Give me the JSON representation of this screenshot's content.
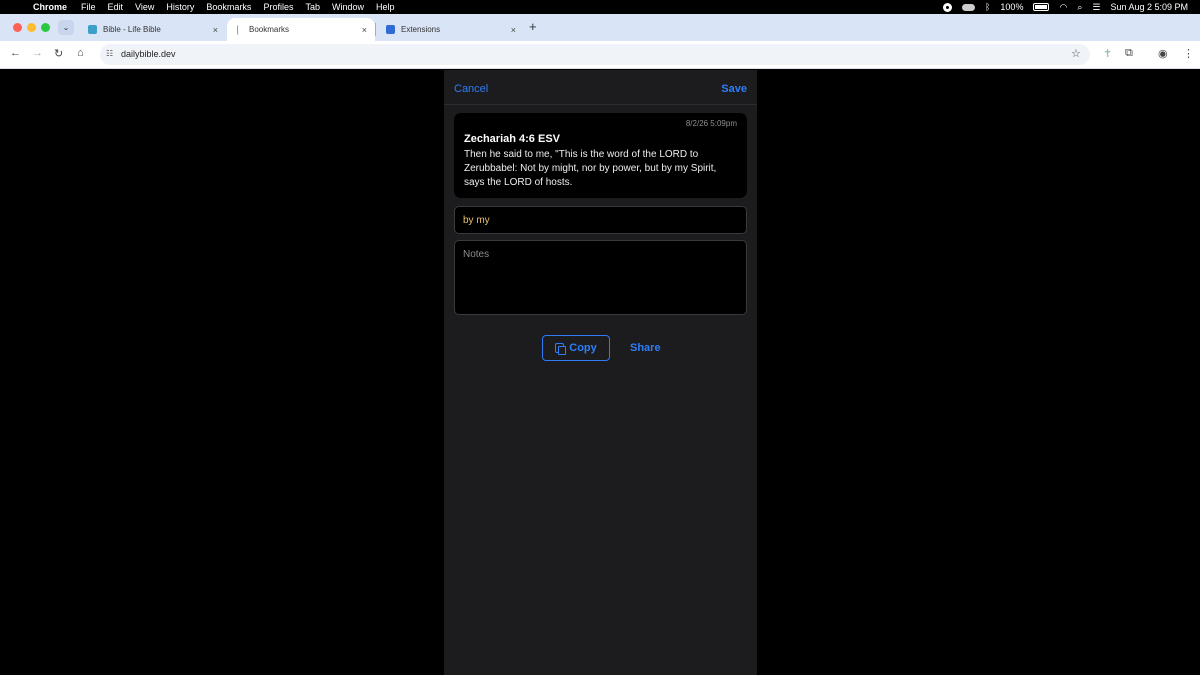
{
  "menubar": {
    "app": "Chrome",
    "items": [
      "File",
      "Edit",
      "View",
      "History",
      "Bookmarks",
      "Profiles",
      "Tab",
      "Window",
      "Help"
    ],
    "battery": "100%",
    "datetime": "Sun Aug 2  5:09 PM"
  },
  "tabs": [
    {
      "title": "Bible - Life Bible",
      "close": "×"
    },
    {
      "title": "Bookmarks",
      "close": "×"
    },
    {
      "title": "Extensions",
      "close": "×"
    }
  ],
  "newtab": "+",
  "toolbar": {
    "url": "dailybible.dev"
  },
  "panel": {
    "cancel_label": "Cancel",
    "save_label": "Save",
    "verse": {
      "date": "8/2/26 5:09pm",
      "reference": "Zechariah 4:6 ESV",
      "text": "Then he said to me, \"This is the word of the LORD to Zerubbabel: Not by might, nor by power, but by my Spirit, says the LORD of hosts."
    },
    "title_value": "by my",
    "notes_placeholder": "Notes",
    "copy_label": "Copy",
    "share_label": "Share"
  },
  "colors": {
    "accent": "#2f7df6",
    "input_text": "#e7c26a",
    "panel_bg": "#1c1c1e"
  }
}
